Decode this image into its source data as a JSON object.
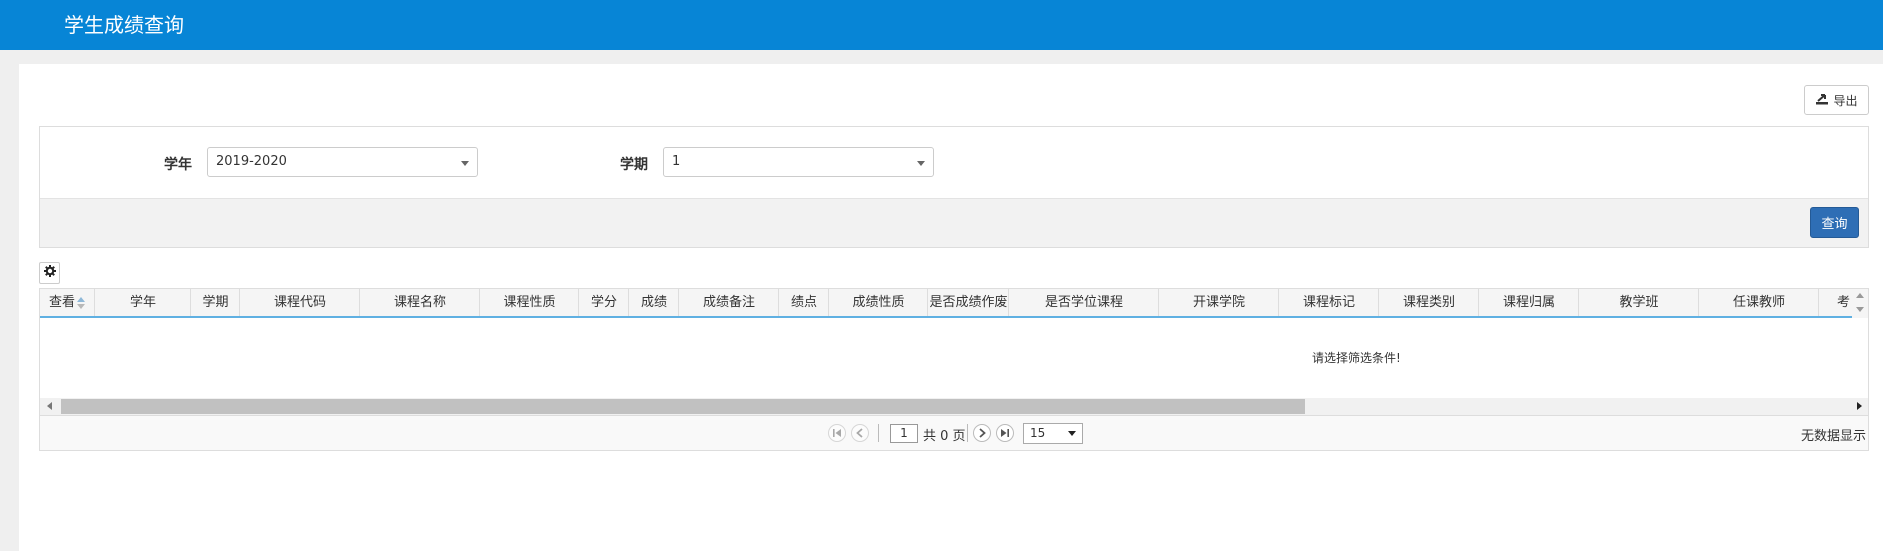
{
  "header": {
    "title": "学生成绩查询"
  },
  "toolbar": {
    "export_label": "导出"
  },
  "filters": {
    "year_label": "学年",
    "year_value": "2019-2020",
    "term_label": "学期",
    "term_value": "1",
    "query_label": "查询"
  },
  "grid": {
    "columns": [
      "查看",
      "学年",
      "学期",
      "课程代码",
      "课程名称",
      "课程性质",
      "学分",
      "成绩",
      "成绩备注",
      "绩点",
      "成绩性质",
      "是否成绩作废",
      "是否学位课程",
      "开课学院",
      "课程标记",
      "课程类别",
      "课程归属",
      "教学班",
      "任课教师",
      "考"
    ],
    "empty_message": "请选择筛选条件!"
  },
  "pager": {
    "current_page": "1",
    "total_text": "共 0 页",
    "page_size": "15",
    "status_text": "无数据显示"
  },
  "colors": {
    "topbar": "#0785d6",
    "primary_button": "#2e6eb5",
    "header_underline": "#5fb0e2"
  },
  "icons": [
    "export-icon",
    "gear-icon",
    "sort-icon",
    "first-page-icon",
    "prev-page-icon",
    "next-page-icon",
    "last-page-icon"
  ]
}
